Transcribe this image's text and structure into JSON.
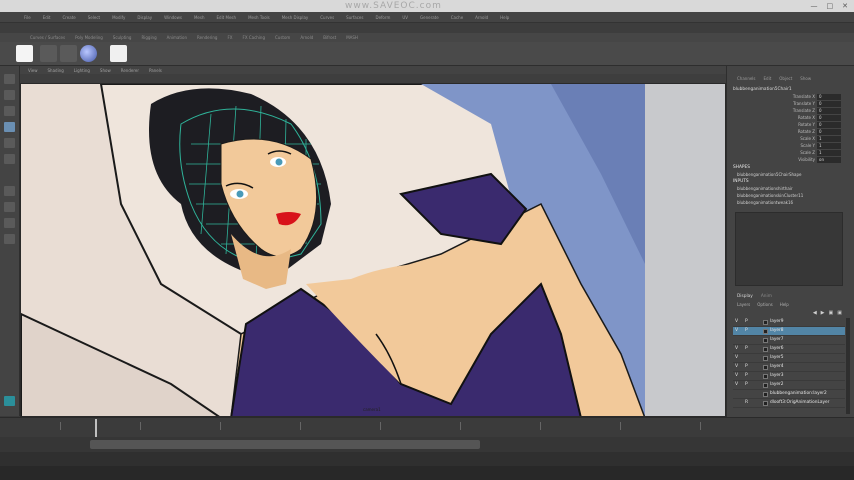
{
  "watermark": "www.SAVEOC.com",
  "menubar": {
    "items": [
      "File",
      "Edit",
      "Create",
      "Select",
      "Modify",
      "Display",
      "Windows",
      "Mesh",
      "Edit Mesh",
      "Mesh Tools",
      "Mesh Display",
      "Curves",
      "Surfaces",
      "Deform",
      "UV",
      "Generate",
      "Cache",
      "Arnold",
      "Help"
    ]
  },
  "shelf": {
    "tabs": [
      "Curves / Surfaces",
      "Poly Modeling",
      "Sculpting",
      "Rigging",
      "Animation",
      "Rendering",
      "FX",
      "FX Caching",
      "Custom",
      "Arnold",
      "Bifrost",
      "MASH"
    ]
  },
  "viewport": {
    "menu": [
      "View",
      "Shading",
      "Lighting",
      "Show",
      "Renderer",
      "Panels"
    ],
    "camera_label": "camera1"
  },
  "channel_box": {
    "tabs": [
      "Channels",
      "Edit",
      "Object",
      "Show"
    ],
    "node_name": "blubbenganimation5Chair1",
    "attributes": [
      {
        "label": "Translate X",
        "value": "0"
      },
      {
        "label": "Translate Y",
        "value": "0"
      },
      {
        "label": "Translate Z",
        "value": "0"
      },
      {
        "label": "Rotate X",
        "value": "0"
      },
      {
        "label": "Rotate Y",
        "value": "0"
      },
      {
        "label": "Rotate Z",
        "value": "0"
      },
      {
        "label": "Scale X",
        "value": "1"
      },
      {
        "label": "Scale Y",
        "value": "1"
      },
      {
        "label": "Scale Z",
        "value": "1"
      },
      {
        "label": "Visibility",
        "value": "on"
      }
    ],
    "shapes_header": "SHAPES",
    "shapes": [
      "blubbenganimation5ChairShape"
    ],
    "inputs_header": "INPUTS",
    "inputs": [
      "blubbenganimationshirthair",
      "blubbenganimationskinCluster11",
      "blubbenganimationtweak16"
    ]
  },
  "layer_editor": {
    "tabs": [
      "Display",
      "Anim"
    ],
    "menu": [
      "Layers",
      "Options",
      "Help"
    ],
    "tools": [
      "◀",
      "▶",
      "▣",
      "▣"
    ],
    "layers": [
      {
        "v": "V",
        "p": "P",
        "name": "layer9"
      },
      {
        "v": "V",
        "p": "P",
        "name": "layer8"
      },
      {
        "v": "",
        "p": "",
        "name": "layer7"
      },
      {
        "v": "V",
        "p": "P",
        "name": "layer6"
      },
      {
        "v": "V",
        "p": "",
        "name": "layer5"
      },
      {
        "v": "V",
        "p": "P",
        "name": "layer4"
      },
      {
        "v": "V",
        "p": "P",
        "name": "layer3"
      },
      {
        "v": "V",
        "p": "P",
        "name": "layer2"
      },
      {
        "v": "",
        "p": "",
        "name": "blubbenganimation:layer2"
      },
      {
        "v": "",
        "p": "R",
        "name": "dlooft3:OrigAnimationLayer"
      }
    ],
    "selected_layer": "layer8"
  },
  "colors": {
    "accent": "#5285a6",
    "skin": "#f2c99a",
    "shirt": "#3a2a6e",
    "hair": "#1d1d22",
    "wire": "#2fb49a",
    "bed": "#efe3da",
    "blanket": "#7f95c8"
  }
}
